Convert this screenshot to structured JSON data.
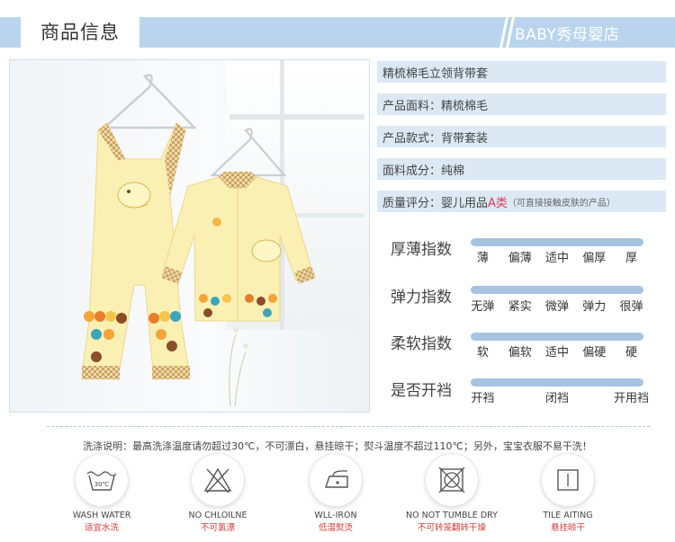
{
  "header": {
    "title": "商品信息",
    "store": "BABY秀母婴店"
  },
  "info": [
    {
      "text": "精梳棉毛立领背带套"
    },
    {
      "text": "产品面料：精梳棉毛"
    },
    {
      "text": "产品款式：背带套装"
    },
    {
      "text": "面料成分：纯棉"
    },
    {
      "prefix": "质量评分：婴儿用品",
      "grade": "A类",
      "note": "（可直接接触皮肤的产品）"
    }
  ],
  "ratings": [
    {
      "label": "厚薄指数",
      "options": [
        "薄",
        "偏薄",
        "适中",
        "偏厚",
        "厚"
      ],
      "selected": 0.5
    },
    {
      "label": "弹力指数",
      "options": [
        "无弹",
        "紧实",
        "微弹",
        "弹力",
        "很弹"
      ],
      "selected": 0.5
    },
    {
      "label": "柔软指数",
      "options": [
        "软",
        "偏软",
        "适中",
        "偏硬",
        "硬"
      ],
      "selected": 0.3
    },
    {
      "label": "是否开裆",
      "options": [
        "开裆",
        "闭裆",
        "开用裆"
      ],
      "selected": 0.05
    }
  ],
  "washing": {
    "note": "洗涤说明：最高洗涤温度请勿超过30℃，不可漂白，悬挂晾干；熨斗温度不超过110℃；另外，宝宝衣服不易干洗！",
    "icons": [
      {
        "name": "wash-water-icon",
        "en": "WASH WATER",
        "zh": "适宜水洗",
        "inner": "30℃"
      },
      {
        "name": "no-chlorine-icon",
        "en": "NO CHLOILNE",
        "zh": "不可氯漂"
      },
      {
        "name": "iron-icon",
        "en": "WLL-IRON",
        "zh": "低温熨烫"
      },
      {
        "name": "no-tumble-dry-icon",
        "en": "NO NOT TUMBLE DRY",
        "zh": "不可转笼翻转干燥"
      },
      {
        "name": "tile-airing-icon",
        "en": "TILE AITING",
        "zh": "悬挂晾干"
      }
    ]
  },
  "colors": {
    "accent": "#b9d4ec",
    "row_bg": "#dce9f4",
    "bar": "#a6c4e2",
    "highlight": "#e43a5a"
  }
}
